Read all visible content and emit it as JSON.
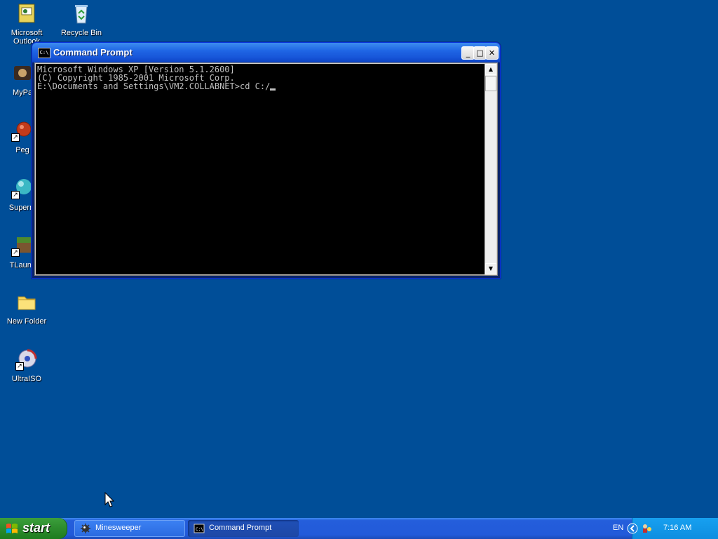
{
  "desktop": {
    "icons": [
      {
        "label": "Microsoft Outlook",
        "icon": "outlook-icon"
      },
      {
        "label": "Recycle Bin",
        "icon": "recycle-bin-icon"
      },
      {
        "label": "MyPa",
        "icon": "mypa-app-icon"
      },
      {
        "label": "Peg",
        "icon": "peg-app-icon"
      },
      {
        "label": "Superm",
        "icon": "superm-app-icon"
      },
      {
        "label": "TLaunc",
        "icon": "tlauncher-icon"
      },
      {
        "label": "New Folder",
        "icon": "folder-icon"
      },
      {
        "label": "UltraISO",
        "icon": "ultraiso-icon"
      }
    ]
  },
  "window": {
    "title": "Command Prompt",
    "app_icon_text": "C:\\",
    "buttons": {
      "minimize": "_",
      "maximize": "□",
      "close": "✕"
    },
    "console_lines": [
      "Microsoft Windows XP [Version 5.1.2600]",
      "(C) Copyright 1985-2001 Microsoft Corp.",
      "",
      "E:\\Documents and Settings\\VM2.COLLABNET>cd C:/"
    ]
  },
  "taskbar": {
    "start_label": "start",
    "tasks": [
      {
        "label": "Minesweeper",
        "icon": "minesweeper-icon",
        "active": false
      },
      {
        "label": "Command Prompt",
        "icon": "cmd-icon",
        "active": true
      }
    ],
    "tray": {
      "language": "EN",
      "time": "7:16 AM"
    }
  },
  "colors": {
    "desktop_bg": "#004e98",
    "console_bg": "#000000",
    "console_text": "#c0c0c0",
    "taskbar": "#245edb",
    "start_green": "#2f8f2f"
  }
}
